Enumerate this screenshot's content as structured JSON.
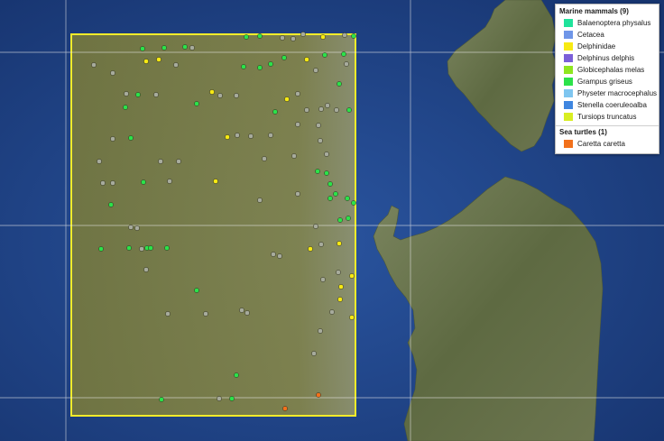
{
  "legend": {
    "groups": [
      {
        "title": "Marine mammals (9)",
        "items": [
          {
            "label": "Balaenoptera physalus",
            "color": "#1fe39b"
          },
          {
            "label": "Cetacea",
            "color": "#6f96e8"
          },
          {
            "label": "Delphinidae",
            "color": "#f7ea13"
          },
          {
            "label": "Delphinus delphis",
            "color": "#7b5fd8"
          },
          {
            "label": "Globicephalas melas",
            "color": "#8fe61f"
          },
          {
            "label": "Grampus griseus",
            "color": "#2ce24a"
          },
          {
            "label": "Physeter macrocephalus",
            "color": "#7fc6f0"
          },
          {
            "label": "Stenella coeruleoalba",
            "color": "#3f86e0"
          },
          {
            "label": "Tursiops truncatus",
            "color": "#d8ee22"
          }
        ]
      },
      {
        "title": "Sea turtles (1)",
        "items": [
          {
            "label": "Caretta caretta",
            "color": "#f2711c"
          }
        ]
      }
    ]
  },
  "colors": {
    "ocean": "#1f4488",
    "land": "#6e7a4e",
    "study_area_fill": "#8a8a3a",
    "study_area_border": "#f4ec2a",
    "grid_line": "#e8e8e8",
    "sighting_gray": "#a7ab9c"
  }
}
